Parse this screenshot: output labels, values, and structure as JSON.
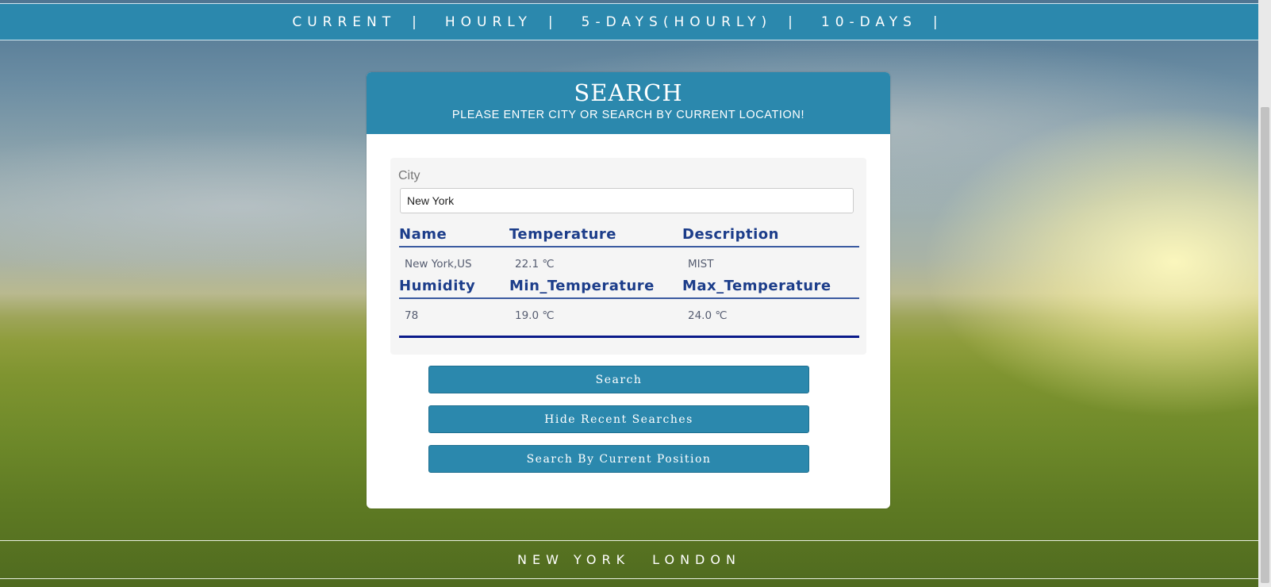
{
  "nav": {
    "items": [
      {
        "label": "CURRENT",
        "sep": "|"
      },
      {
        "label": "HOURLY",
        "sep": "|"
      },
      {
        "label": "5-DAYS(HOURLY)",
        "sep": "|"
      },
      {
        "label": "10-DAYS",
        "sep": "|"
      }
    ]
  },
  "card": {
    "title": "SEARCH",
    "subtitle": "PLEASE ENTER CITY OR SEARCH BY CURRENT LOCATION!"
  },
  "form": {
    "city_label": "City",
    "city_value": "New York"
  },
  "results": {
    "headers_row1": [
      "Name",
      "Temperature",
      "Description"
    ],
    "values_row1": [
      "New York,US",
      "22.1 ℃",
      "MIST"
    ],
    "headers_row2": [
      "Humidity",
      "Min_Temperature",
      "Max_Temperature"
    ],
    "values_row2": [
      "78",
      "19.0 ℃",
      "24.0 ℃"
    ]
  },
  "buttons": {
    "search": "Search",
    "hide_recent": "Hide Recent Searches",
    "current_position": "Search By Current Position"
  },
  "footer": {
    "cities": [
      "NEW YORK",
      "LONDON"
    ]
  },
  "colors": {
    "accent": "#2b88ad",
    "header_text": "#1c3d8a",
    "rule": "#0a1a8a"
  }
}
